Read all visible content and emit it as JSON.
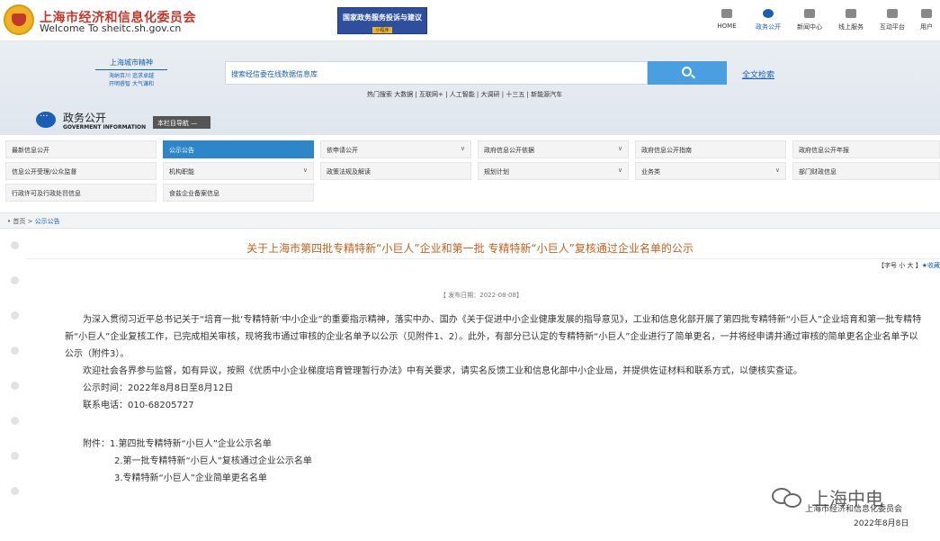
{
  "header": {
    "site_name": "上海市经济和信息化委员会",
    "site_url": "Welcome To sheitc.sh.gov.cn",
    "banner_title": "国家政务服务投诉与建议",
    "banner_sub": "小程序",
    "nav": [
      {
        "label": "HOME",
        "icon": "home-icon"
      },
      {
        "label": "政务公开",
        "icon": "chat-icon"
      },
      {
        "label": "新闻中心",
        "icon": "book-icon"
      },
      {
        "label": "线上服务",
        "icon": "people-icon"
      },
      {
        "label": "互动平台",
        "icon": "grid-icon"
      },
      {
        "label": "用户",
        "icon": "user-icon"
      }
    ]
  },
  "hero": {
    "motto_title": "上海城市精神",
    "motto_line1": "海纳百川 追求卓越",
    "motto_line2": "开明睿智 大气谦和",
    "search_placeholder": "搜索经信委在线数据信息库",
    "fulltext_label": "全文检索",
    "hot_text": "热门搜索  大数据 | 互联网+ | 人工智能 | 大调研 | 十三五 | 新能源汽车"
  },
  "section": {
    "title": "政务公开",
    "subtitle": "GOVERMENT INFORMATION",
    "col_nav": "本栏目导航 —"
  },
  "categories": [
    {
      "label": "最新信息公开",
      "chev": ""
    },
    {
      "label": "公示公告",
      "chev": ""
    },
    {
      "label": "依申请公开",
      "chev": "∨"
    },
    {
      "label": "政府信息公开依据",
      "chev": "∨"
    },
    {
      "label": "政府信息公开指南",
      "chev": ""
    },
    {
      "label": "政府信息公开年报",
      "chev": ""
    },
    {
      "label": "信息公开受理/公众监督",
      "chev": ""
    },
    {
      "label": "机构职能",
      "chev": "∨"
    },
    {
      "label": "政策法规及解读",
      "chev": ""
    },
    {
      "label": "规划计划",
      "chev": "∨"
    },
    {
      "label": "业务类",
      "chev": "∨"
    },
    {
      "label": "部门财政信息",
      "chev": ""
    },
    {
      "label": "行政许可及行政处罚信息",
      "chev": ""
    },
    {
      "label": "食盐企业备案信息",
      "chev": ""
    }
  ],
  "breadcrumb": {
    "home": "首页",
    "sep": " > ",
    "current": "公示公告"
  },
  "article": {
    "title": "关于上海市第四批专精特新“小巨人”企业和第一批 专精特新“小巨人”复核通过企业名单的公示",
    "fontsize_label": "【字号  小    大  】",
    "fav": "★收藏",
    "pubdate": "【 发布日期：2022-08-08】",
    "para1": "为深入贯彻习近平总书记关于“培育一批‘专精特新’中小企业”的重要指示精神，落实中办、国办《关于促进中小企业健康发展的指导意见》，工业和信息化部开展了第四批专精特新“小巨人”企业培育和第一批专精特新“小巨人”企业复核工作，已完成相关审核，现将我市通过审核的企业名单予以公示（见附件1、2）。此外，有部分已认定的专精特新“小巨人”企业进行了简单更名，一并将经申请并通过审核的简单更名企业名单予以公示（附件3）。",
    "para2": "欢迎社会各界参与监督，如有异议，按照《优质中小企业梯度培育管理暂行办法》中有关要求，请实名反馈工业和信息化部中小企业局，并提供佐证材料和联系方式，以便核实查证。",
    "time_line": "公示时间：2022年8月8日至8月12日",
    "phone_line": "联系电话：010-68205727",
    "attach_label": "附件：",
    "attachments": [
      "1.第四批专精特新“小巨人”企业公示名单",
      "2.第一批专精特新“小巨人”复核通过企业公示名单",
      "3.专精特新“小巨人”企业简单更名名单"
    ],
    "sign_org": "上海市经济和信息化委员会",
    "sign_date": "2022年8月8日"
  },
  "watermark": {
    "text": "上海中电"
  }
}
